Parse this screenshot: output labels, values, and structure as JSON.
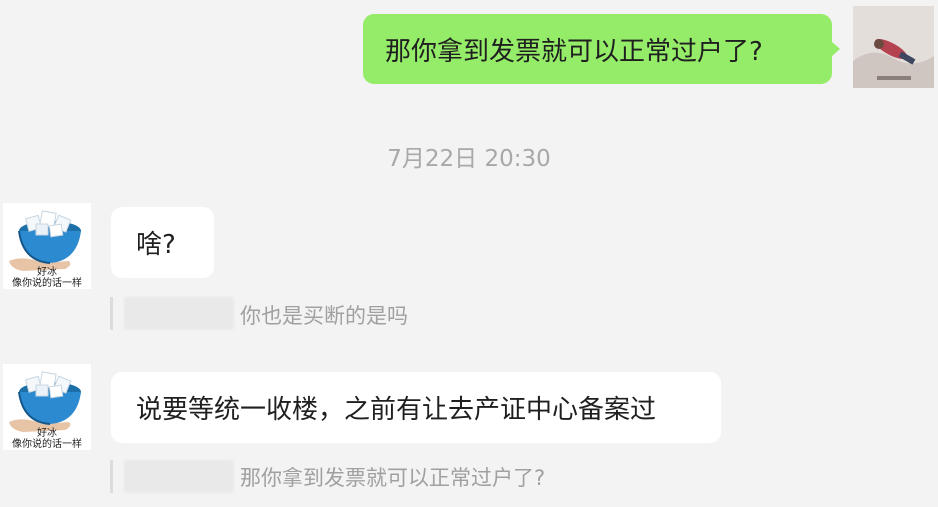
{
  "messages": [
    {
      "side": "right",
      "text": "那你拿到发票就可以正常过户了?"
    },
    {
      "side": "left",
      "text": "啥?",
      "quote": "你也是买断的是吗"
    },
    {
      "side": "left",
      "text": "说要等统一收楼，之前有让去产证中心备案过",
      "quote": "那你拿到发票就可以正常过户了?"
    }
  ],
  "time_divider": "7月22日 20:30",
  "avatars": {
    "me": {
      "icon": "photo-avatar-icon"
    },
    "them": {
      "icon": "ice-bowl-avatar-icon",
      "caption_line1": "好冰",
      "caption_line2": "像你说的话一样"
    }
  },
  "colors": {
    "background": "#f3f3f3",
    "outgoing_bubble": "#95ec69",
    "incoming_bubble": "#ffffff",
    "meta_text": "#a8a8a8"
  }
}
